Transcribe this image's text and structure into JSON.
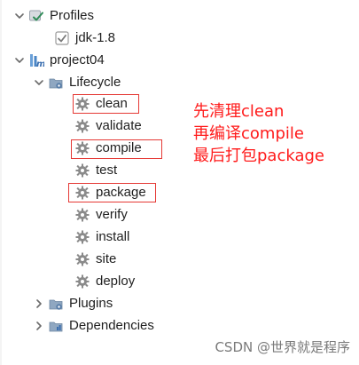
{
  "tree": {
    "profiles_label": "Profiles",
    "profile_item_label": "jdk-1.8",
    "project_label": "project04",
    "lifecycle_label": "Lifecycle",
    "lifecycle_items": [
      "clean",
      "validate",
      "compile",
      "test",
      "package",
      "verify",
      "install",
      "site",
      "deploy"
    ],
    "plugins_label": "Plugins",
    "dependencies_label": "Dependencies"
  },
  "annotation": {
    "line1": "先清理clean",
    "line2": "再编译compile",
    "line3": "最后打包package"
  },
  "watermark": "CSDN @世界就是程序",
  "colors": {
    "highlight": "#e53935",
    "annotation_text": "#ff1a1a",
    "gear": "#8a8a8a",
    "chevron": "#6b6b6b"
  },
  "icons": {
    "profiles": "profiles-icon",
    "profile_item": "checkbox-checked-icon",
    "project": "maven-module-icon",
    "lifecycle": "folder-gear-icon",
    "lifecycle_item": "gear-icon",
    "plugins": "folder-gear-icon",
    "dependencies": "dependencies-icon"
  }
}
